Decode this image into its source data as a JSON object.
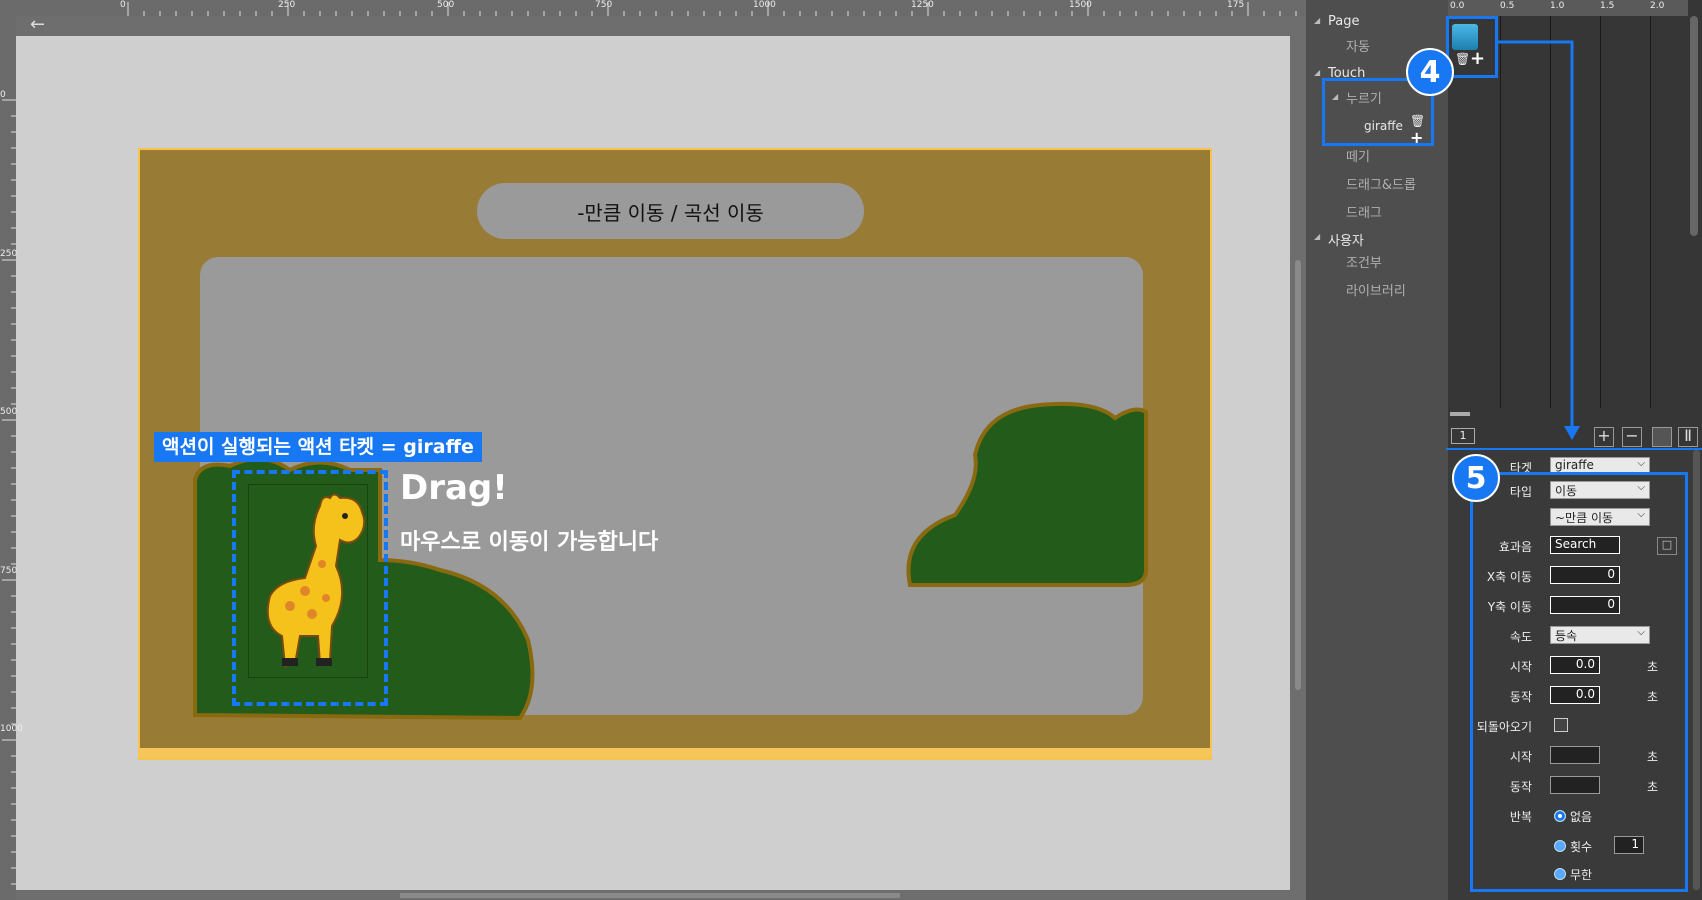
{
  "ruler": {
    "top_labels": [
      "0",
      "250",
      "500",
      "750",
      "1000",
      "1250",
      "1500",
      "175"
    ],
    "left_labels": [
      "0",
      "250",
      "500",
      "750",
      "1000"
    ]
  },
  "stage": {
    "title": "-만큼 이동 / 곡선 이동",
    "drag_title": "Drag!",
    "drag_subtitle": "마우스로 이동이 가능합니다",
    "target_label": "액션이 실행되는 액션 타켓 = giraffe"
  },
  "tree": {
    "groups": [
      {
        "label": "Page",
        "items": [
          "자동"
        ]
      },
      {
        "label": "Touch",
        "items": [
          "누르기",
          "떼기",
          "드래그&드롭",
          "드래그"
        ]
      },
      {
        "label": "사용자",
        "items": [
          "조건부",
          "라이브러리"
        ]
      }
    ],
    "selected_target": "giraffe"
  },
  "timeline": {
    "ruler_labels": [
      "0.0",
      "0.5",
      "1.0",
      "1.5",
      "2.0"
    ],
    "page_number": "1"
  },
  "callouts": {
    "four": "4",
    "five": "5"
  },
  "props": {
    "target_label": "타겟",
    "target_value": "giraffe",
    "type_label": "타입",
    "type_value": "이동",
    "subtype_value": "~만큼 이동",
    "sound_label": "효과음",
    "sound_value": "Search",
    "x_label": "X축 이동",
    "x_value": "0",
    "y_label": "Y축 이동",
    "y_value": "0",
    "speed_label": "속도",
    "speed_value": "등속",
    "start_label": "시작",
    "start_value": "0.0",
    "action_label": "동작",
    "action_value": "0.0",
    "return_label": "되돌아오기",
    "start2_label": "시작",
    "action2_label": "동작",
    "repeat_label": "반복",
    "opt_none": "없음",
    "opt_count": "횟수",
    "count_value": "1",
    "opt_infinite": "무한",
    "unit": "초"
  }
}
